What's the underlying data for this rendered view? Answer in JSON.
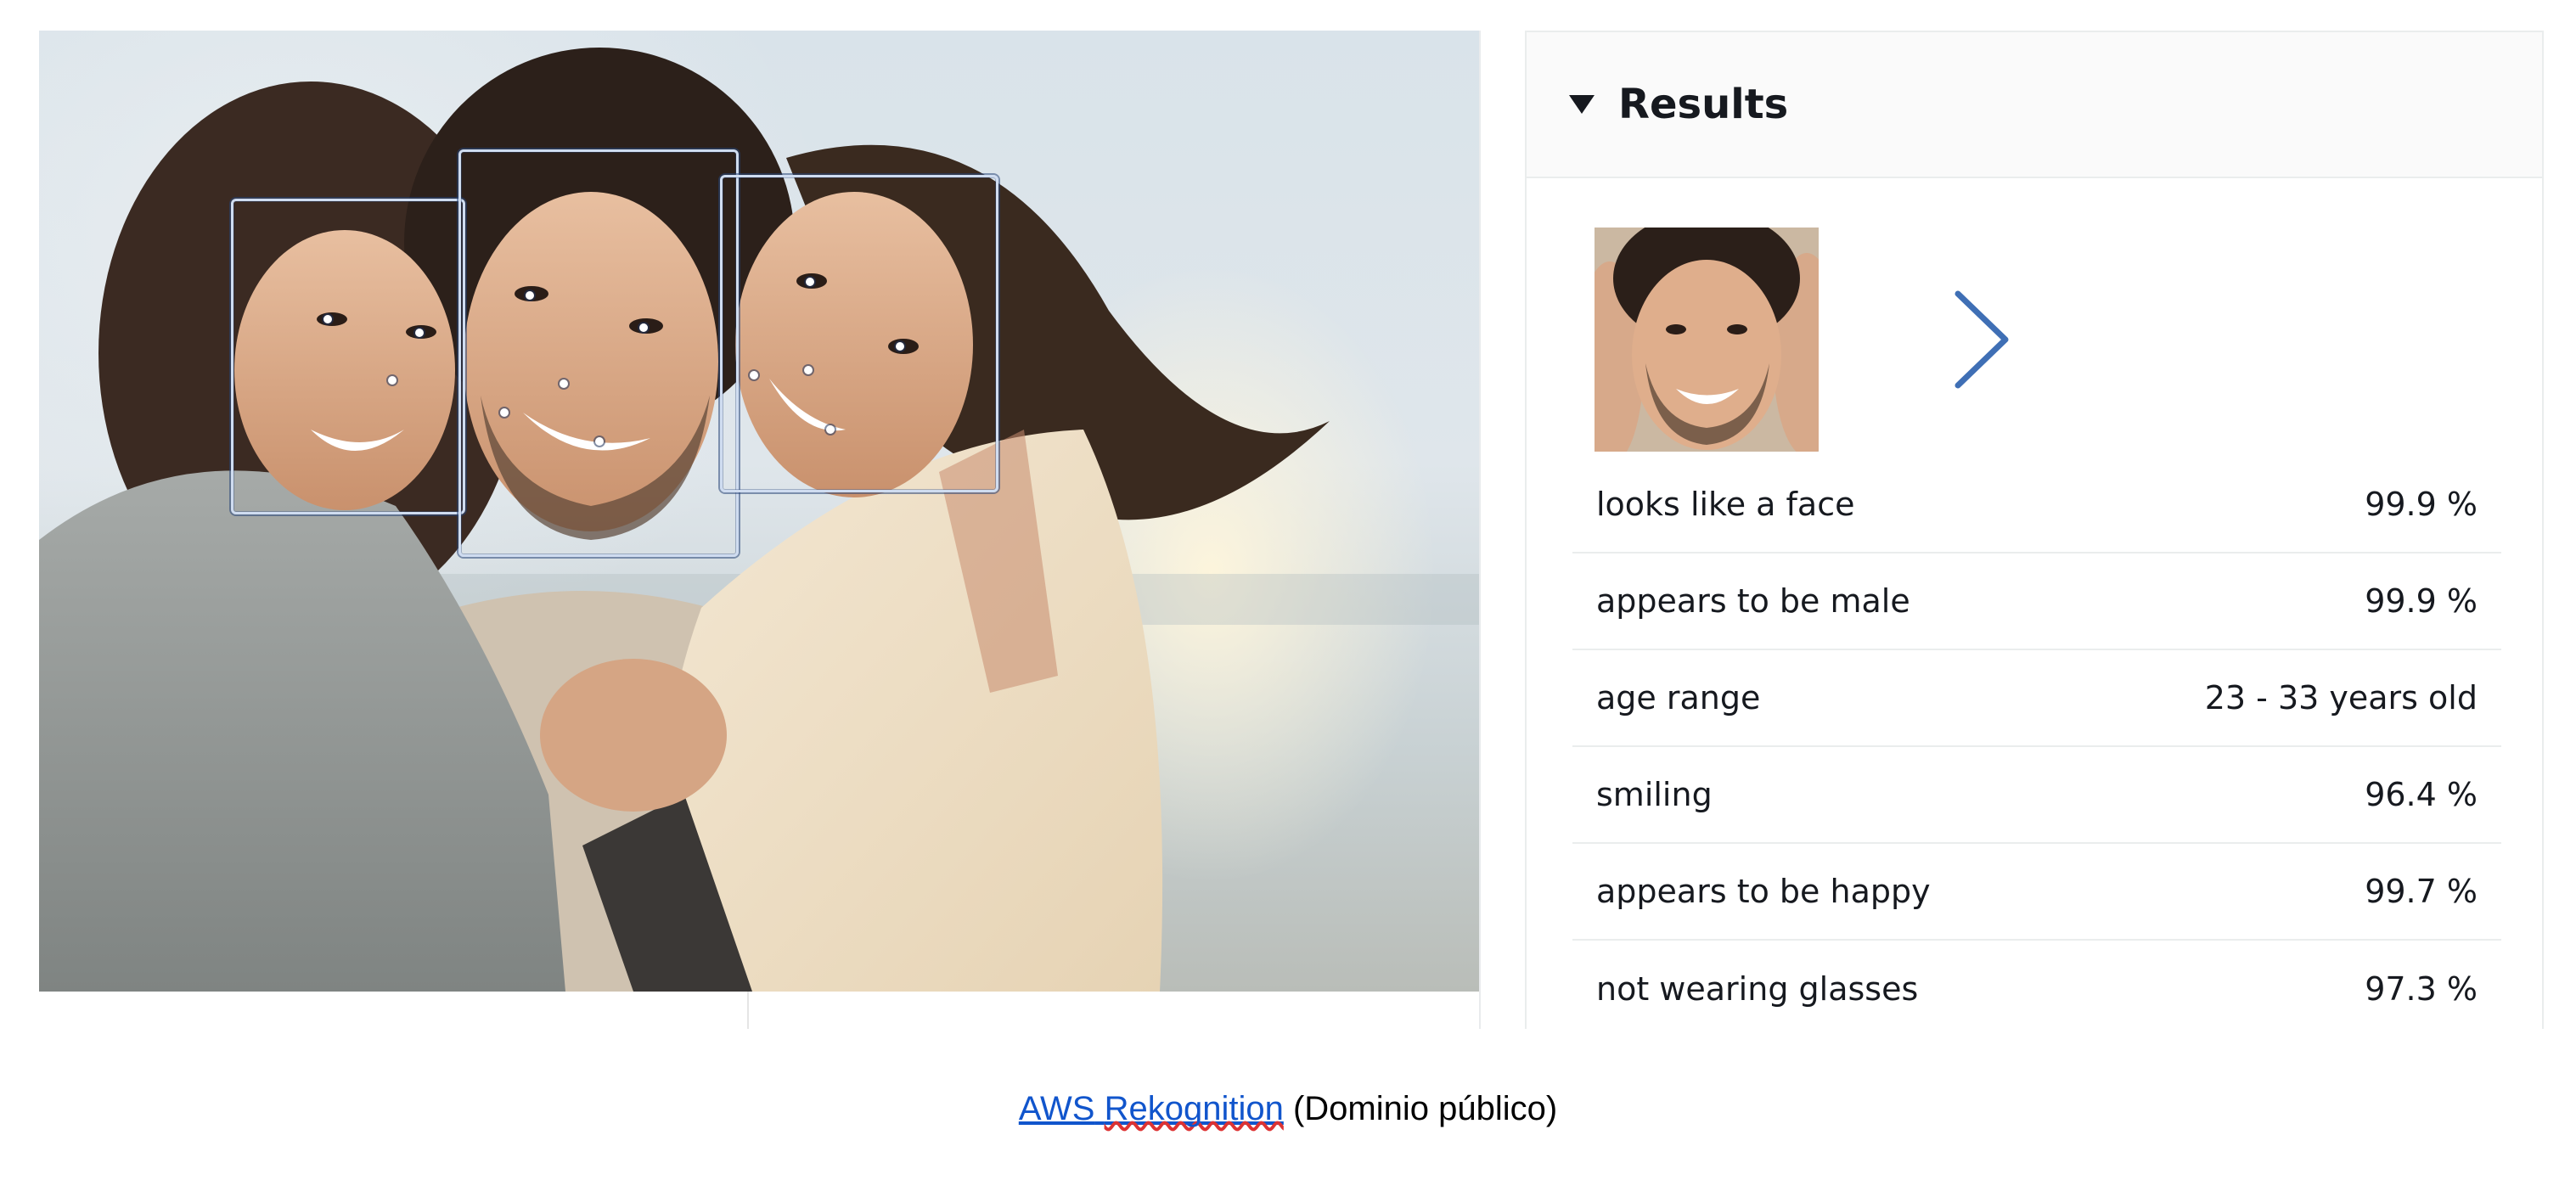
{
  "photo": {
    "alt": "Family photo with detected faces",
    "faces": [
      {
        "label": "face-1"
      },
      {
        "label": "face-2"
      },
      {
        "label": "face-3"
      }
    ]
  },
  "results_panel": {
    "title": "Results",
    "toggle_icon": "caret-down-icon",
    "next_icon": "chevron-right-icon",
    "rows": [
      {
        "label": "looks like a face",
        "value": "99.9 %"
      },
      {
        "label": "appears to be male",
        "value": "99.9 %"
      },
      {
        "label": "age range",
        "value": "23 - 33 years old"
      },
      {
        "label": "smiling",
        "value": "96.4 %"
      },
      {
        "label": "appears to be happy",
        "value": "99.7 %"
      },
      {
        "label": "not wearing glasses",
        "value": "97.3 %"
      }
    ]
  },
  "caption": {
    "link_text_1": "AWS",
    "link_text_2": "Rekognition",
    "suffix": "(Dominio público)"
  },
  "colors": {
    "accent_arrow": "#3f6fb5",
    "link": "#1155cc",
    "box_stroke": "#cfdcf0"
  }
}
